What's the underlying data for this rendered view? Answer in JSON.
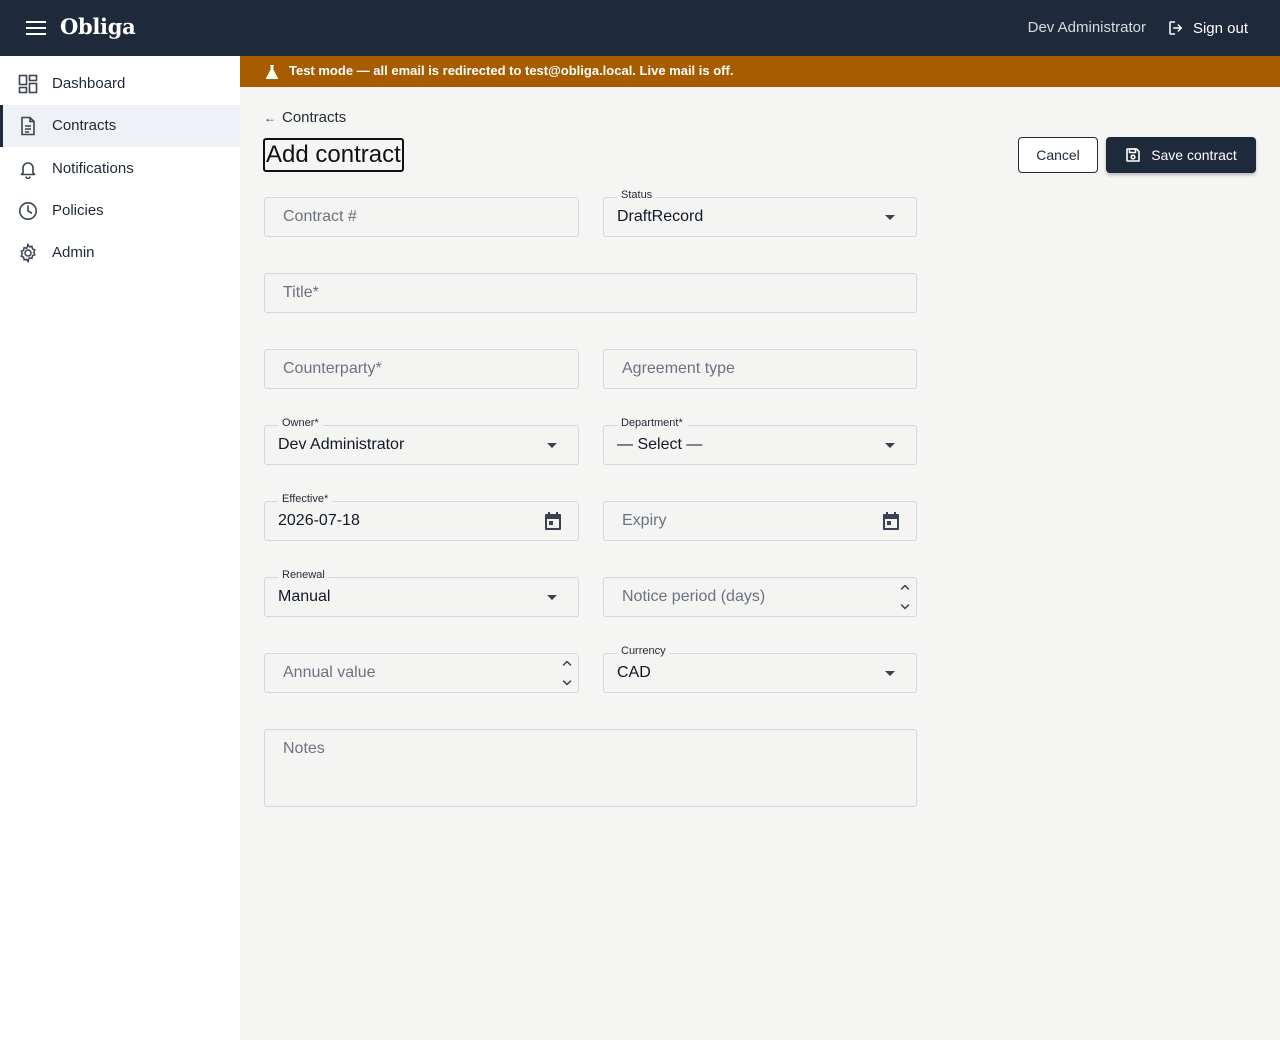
{
  "app": {
    "name": "Obliga"
  },
  "header": {
    "user_name": "Dev Administrator",
    "signout_label": "Sign out"
  },
  "sidebar": {
    "items": [
      {
        "label": "Dashboard",
        "icon": "dashboard-icon"
      },
      {
        "label": "Contracts",
        "icon": "document-icon",
        "active": true
      },
      {
        "label": "Notifications",
        "icon": "bell-icon"
      },
      {
        "label": "Policies",
        "icon": "clock-icon"
      },
      {
        "label": "Admin",
        "icon": "gear-icon"
      }
    ]
  },
  "banner": {
    "text": "Test mode — all email is redirected to test@obliga.local. Live mail is off.",
    "color": "#a75c00"
  },
  "page": {
    "back_label": "Contracts",
    "title": "Add contract",
    "cancel_label": "Cancel",
    "save_label": "Save contract"
  },
  "form": {
    "contract_no": {
      "placeholder": "Contract #"
    },
    "status": {
      "label": "Status",
      "value": "DraftRecord"
    },
    "title": {
      "placeholder": "Title*"
    },
    "counterparty": {
      "placeholder": "Counterparty*"
    },
    "agreement_type": {
      "placeholder": "Agreement type"
    },
    "owner": {
      "label": "Owner*",
      "value": "Dev Administrator"
    },
    "department": {
      "label": "Department*",
      "value": "— Select —"
    },
    "effective": {
      "label": "Effective*",
      "value": "2026-07-18"
    },
    "expiry": {
      "placeholder": "Expiry"
    },
    "renewal": {
      "label": "Renewal",
      "value": "Manual"
    },
    "notice_period": {
      "placeholder": "Notice period (days)"
    },
    "annual_value": {
      "placeholder": "Annual value"
    },
    "currency": {
      "label": "Currency",
      "value": "CAD"
    },
    "notes": {
      "placeholder": "Notes"
    }
  },
  "colors": {
    "header_bg": "#1e2a3b",
    "banner_bg": "#a75c00",
    "page_bg": "#f5f5f3"
  }
}
